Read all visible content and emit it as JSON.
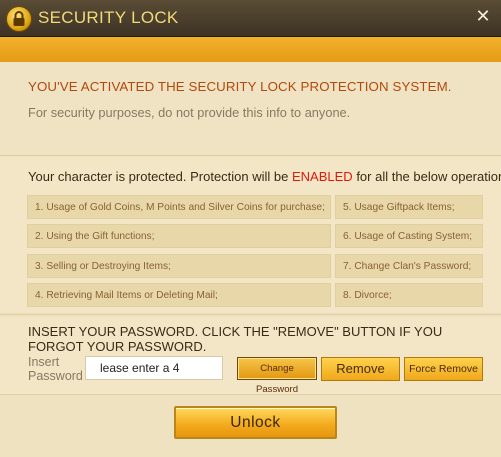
{
  "window": {
    "title": "SECURITY LOCK",
    "close_label": "✕"
  },
  "notice": {
    "heading": "YOU'VE ACTIVATED THE SECURITY LOCK PROTECTION SYSTEM.",
    "subtext": "For security purposes, do not provide this info to anyone."
  },
  "protection": {
    "text_before": "Your character is protected. Protection will be ",
    "enabled_word": "ENABLED",
    "text_after": " for all the below operations:",
    "enabled_color": "#e01a0a",
    "operations": [
      "1. Usage of Gold Coins, M Points and Silver Coins for purchase;",
      "2. Using the Gift functions;",
      "3. Selling or Destroying Items;",
      "4. Retrieving Mail Items or Deleting Mail;",
      "5. Usage Giftpack Items;",
      "6. Usage of Casting System;",
      "7. Change Clan's Password;",
      "8. Divorce;"
    ]
  },
  "password": {
    "instructions": "INSERT YOUR PASSWORD. CLICK THE \"REMOVE\" BUTTON IF YOU FORGOT YOUR PASSWORD.",
    "label": "Insert Password",
    "input_value": "lease enter a 4",
    "change_label": "Change Password",
    "remove_label": "Remove",
    "force_remove_label": "Force Remove"
  },
  "unlock_label": "Unlock",
  "colors": {
    "accent": "#f0a81b",
    "title": "#f2d97a",
    "heading": "#b04a0e"
  }
}
